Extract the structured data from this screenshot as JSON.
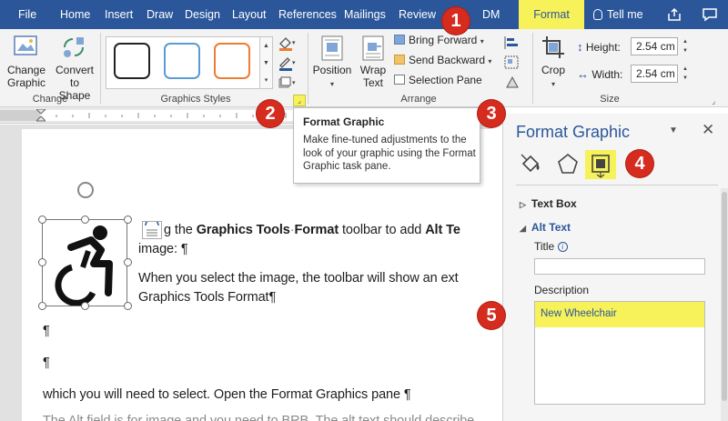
{
  "tabs": [
    {
      "label": "File"
    },
    {
      "label": "Home"
    },
    {
      "label": "Insert"
    },
    {
      "label": "Draw"
    },
    {
      "label": "Design"
    },
    {
      "label": "Layout"
    },
    {
      "label": "References"
    },
    {
      "label": "Mailings"
    },
    {
      "label": "Review"
    },
    {
      "label": "DM"
    },
    {
      "label": "Format"
    }
  ],
  "tell_me": "Tell me",
  "ribbon": {
    "change_graphic": "Change Graphic",
    "convert_to_shape": "Convert to Shape",
    "group_change": "Change",
    "group_graphics_styles": "Graphics Styles",
    "position": "Position",
    "wrap_text": "Wrap Text",
    "bring_forward": "Bring Forward",
    "send_backward": "Send Backward",
    "selection_pane": "Selection Pane",
    "group_arrange": "Arrange",
    "crop": "Crop",
    "height_label": "Height:",
    "height_value": "2.54 cm",
    "width_label": "Width:",
    "width_value": "2.54 cm",
    "group_size": "Size",
    "style_colors": [
      "#222222",
      "#5b9bd5",
      "#ed7d31"
    ]
  },
  "tooltip": {
    "title": "Format Graphic",
    "body": "Make fine-tuned adjustments to the look of your graphic using the Format Graphic task pane."
  },
  "document": {
    "line1_pre": "g the ",
    "line1_bold1": "Graphics Tools",
    "line1_bold2": "Format",
    "line1_post": " toolbar to add ",
    "line1_bold3": "Alt Te",
    "line2": "image: ¶",
    "line3": "When you select the image, the toolbar will show an ext",
    "line4": "Graphics Tools Format¶",
    "para_mark": "¶",
    "line7": "which you will need to select. Open the Format Graphics pane ¶",
    "line8": "The Alt field is for image and you need to BRB. The alt text should describe"
  },
  "pane": {
    "title": "Format Graphic",
    "text_box": "Text Box",
    "alt_text": "Alt Text",
    "title_label": "Title",
    "description_label": "Description",
    "description_value": "New Wheelchair"
  },
  "callouts": [
    "1",
    "2",
    "3",
    "4",
    "5"
  ],
  "colors": {
    "ribbon_blue": "#2b579a",
    "highlight_yellow": "#f7f15a",
    "callout_red": "#d62b1f"
  }
}
